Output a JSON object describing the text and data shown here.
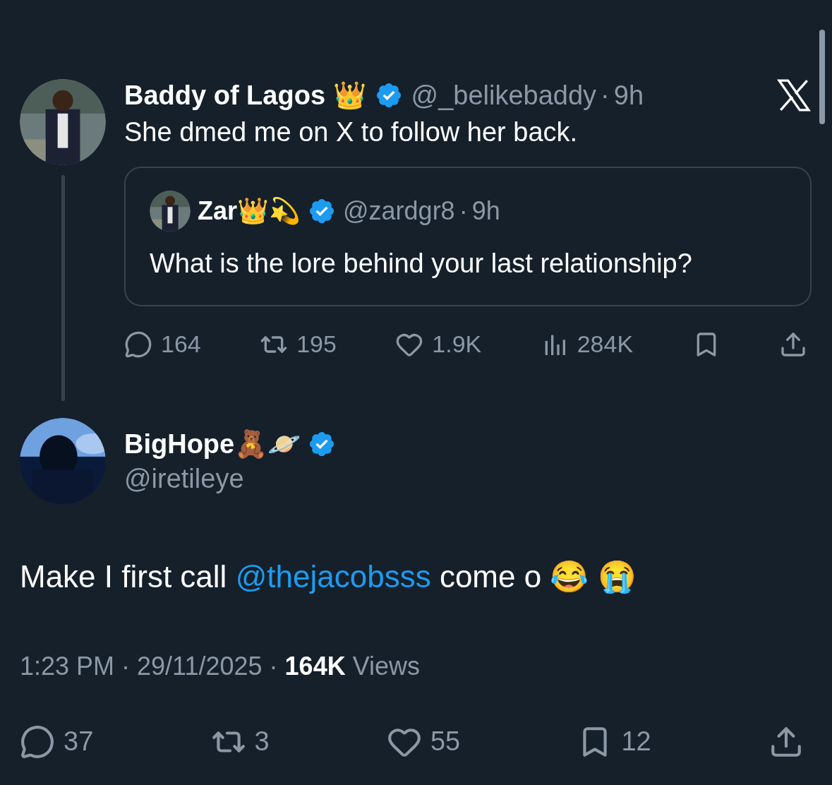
{
  "parent": {
    "name": "Baddy of Lagos 👑",
    "verified": true,
    "handle": "@_belikebaddy",
    "dot": "·",
    "time": "9h",
    "text": "She dmed me on X to follow her back.",
    "quote": {
      "name": "Zar👑💫",
      "verified": true,
      "handle": "@zardgr8",
      "dot": "·",
      "time": "9h",
      "text": "What is the lore behind your last relationship?"
    },
    "actions": [
      {
        "kind": "reply",
        "count": "164"
      },
      {
        "kind": "repost",
        "count": "195"
      },
      {
        "kind": "like",
        "count": "1.9K"
      },
      {
        "kind": "views",
        "count": "284K"
      },
      {
        "kind": "bookmark"
      },
      {
        "kind": "share"
      }
    ]
  },
  "main": {
    "name": "BigHope🧸🪐",
    "verified": true,
    "handle": "@iretileye",
    "text_start": "Make I first call ",
    "mention": "@thejacobsss",
    "text_end": " come o 😂 😭",
    "time": "1:23 PM",
    "dot": "·",
    "date": "29/11/2025",
    "dot2": "·",
    "views_count": "164K",
    "views_label": "Views",
    "actions": [
      {
        "kind": "reply",
        "count": "37"
      },
      {
        "kind": "repost",
        "count": "3"
      },
      {
        "kind": "like",
        "count": "55"
      },
      {
        "kind": "bookmark",
        "count": "12"
      },
      {
        "kind": "share"
      }
    ]
  }
}
